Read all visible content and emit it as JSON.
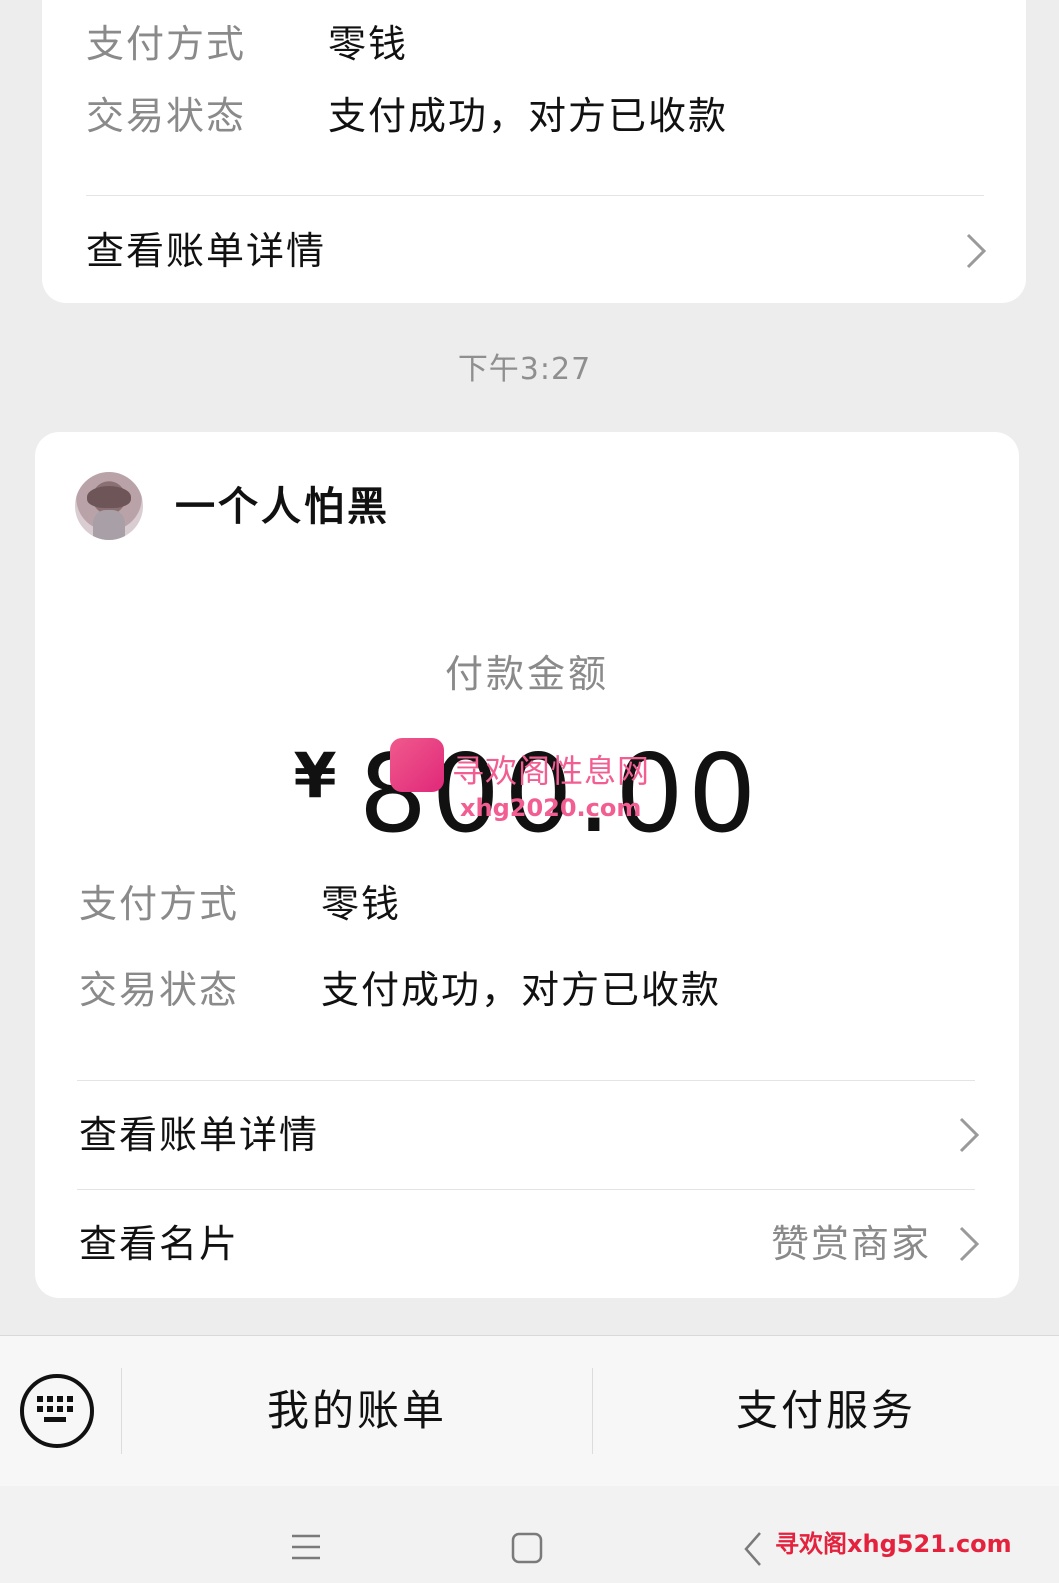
{
  "top_card": {
    "payment_method_label": "支付方式",
    "payment_method_value": "零钱",
    "status_label": "交易状态",
    "status_value": "支付成功，对方已收款",
    "bill_details": "查看账单详情"
  },
  "timestamp": "下午3:27",
  "main_card": {
    "payer_name": "一个人怕黑",
    "amount_label": "付款金额",
    "currency": "¥",
    "amount": "800.00",
    "payment_method_label": "支付方式",
    "payment_method_value": "零钱",
    "status_label": "交易状态",
    "status_value": "支付成功，对方已收款",
    "bill_details": "查看账单详情",
    "view_card": "查看名片",
    "reward_merchant": "赞赏商家"
  },
  "watermarks": {
    "center_line1": "寻欢阁性息网",
    "center_line2": "xhg2020.com",
    "bottom": "寻欢阁xhg521.com"
  },
  "bottom_bar": {
    "my_bills": "我的账单",
    "payment_services": "支付服务"
  },
  "icons": {
    "chevron": "chevron-right-icon",
    "keyboard": "keyboard-icon",
    "nav_menu": "menu-icon",
    "nav_home": "home-square-icon",
    "nav_back": "back-icon"
  },
  "colors": {
    "background": "#ededed",
    "card": "#ffffff",
    "secondary_text": "#8a8a8a",
    "watermark_pink": "#f25d92",
    "watermark_red": "#e4223e"
  }
}
